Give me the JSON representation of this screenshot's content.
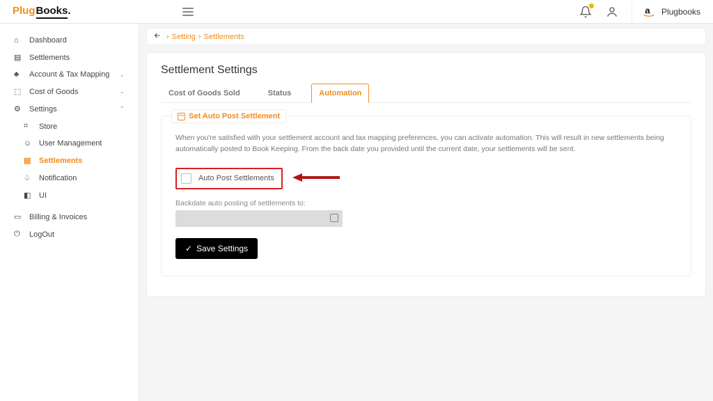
{
  "header": {
    "logo_part1": "Plug",
    "logo_part2": "Books",
    "account_name": "Plugbooks"
  },
  "sidebar": {
    "items": [
      {
        "label": "Dashboard"
      },
      {
        "label": "Settlements"
      },
      {
        "label": "Account & Tax Mapping"
      },
      {
        "label": "Cost of Goods"
      },
      {
        "label": "Settings"
      },
      {
        "label": "Store"
      },
      {
        "label": "User Management"
      },
      {
        "label": "Settlements"
      },
      {
        "label": "Notification"
      },
      {
        "label": "UI"
      },
      {
        "label": "Billing & Invoices"
      },
      {
        "label": "LogOut"
      }
    ]
  },
  "breadcrumb": {
    "root": "Setting",
    "current": "Settlements"
  },
  "page": {
    "title": "Settlement Settings",
    "tabs": [
      {
        "label": "Cost of Goods Sold"
      },
      {
        "label": "Status"
      },
      {
        "label": "Automation"
      }
    ],
    "section_title": "Set Auto Post Settlement",
    "description": "When you're satisfied with your settlement account and tax mapping preferences, you can activate automation. This will result in new settlements being automatically posted to Book Keeping. From the back date you provided until the current date, your settlements will be sent.",
    "checkbox_label": "Auto Post Settlements",
    "backdate_label": "Backdate auto posting of settlements to:",
    "save_label": "Save Settings"
  }
}
